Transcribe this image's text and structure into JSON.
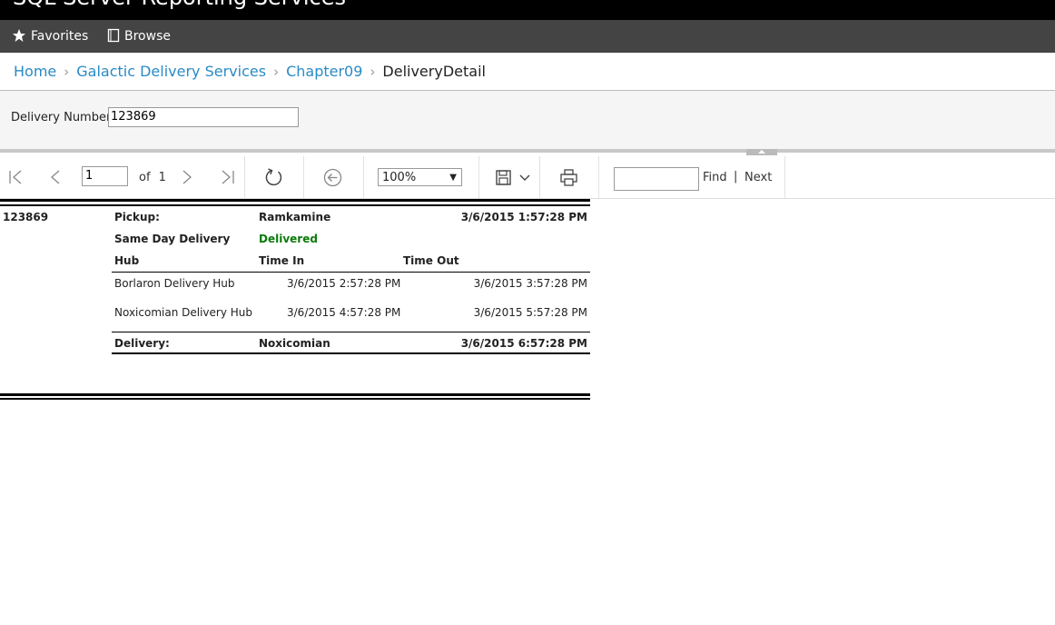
{
  "app": {
    "title": "SQL Server Reporting Services"
  },
  "nav": {
    "favorites": "Favorites",
    "browse": "Browse"
  },
  "breadcrumb": {
    "items": [
      "Home",
      "Galactic Delivery Services",
      "Chapter09"
    ],
    "current": "DeliveryDetail"
  },
  "params": {
    "delivery_number_label": "Delivery Number",
    "delivery_number_value": "123869"
  },
  "toolbar": {
    "page_value": "1",
    "of_label": "of",
    "total_pages": "1",
    "zoom": "100%",
    "find_value": "",
    "find_label": "Find",
    "next_label": "Next",
    "pipe": "|"
  },
  "report": {
    "delivery_number": "123869",
    "pickup_label": "Pickup:",
    "pickup_planet": "Ramkamine",
    "pickup_time": "3/6/2015 1:57:28 PM",
    "service_type": "Same Day Delivery",
    "status": "Delivered",
    "col_hub": "Hub",
    "col_time_in": "Time In",
    "col_time_out": "Time Out",
    "hubs": [
      {
        "hub": "Borlaron Delivery Hub",
        "time_in": "3/6/2015 2:57:28 PM",
        "time_out": "3/6/2015 3:57:28 PM"
      },
      {
        "hub": "Noxicomian Delivery Hub",
        "time_in": "3/6/2015 4:57:28 PM",
        "time_out": "3/6/2015 5:57:28 PM"
      }
    ],
    "delivery_label": "Delivery:",
    "delivery_planet": "Noxicomian",
    "delivery_time": "3/6/2015 6:57:28 PM"
  },
  "colors": {
    "nav_bg": "#444444",
    "link": "#2a8ac6",
    "status_green": "#0a7a0a"
  }
}
